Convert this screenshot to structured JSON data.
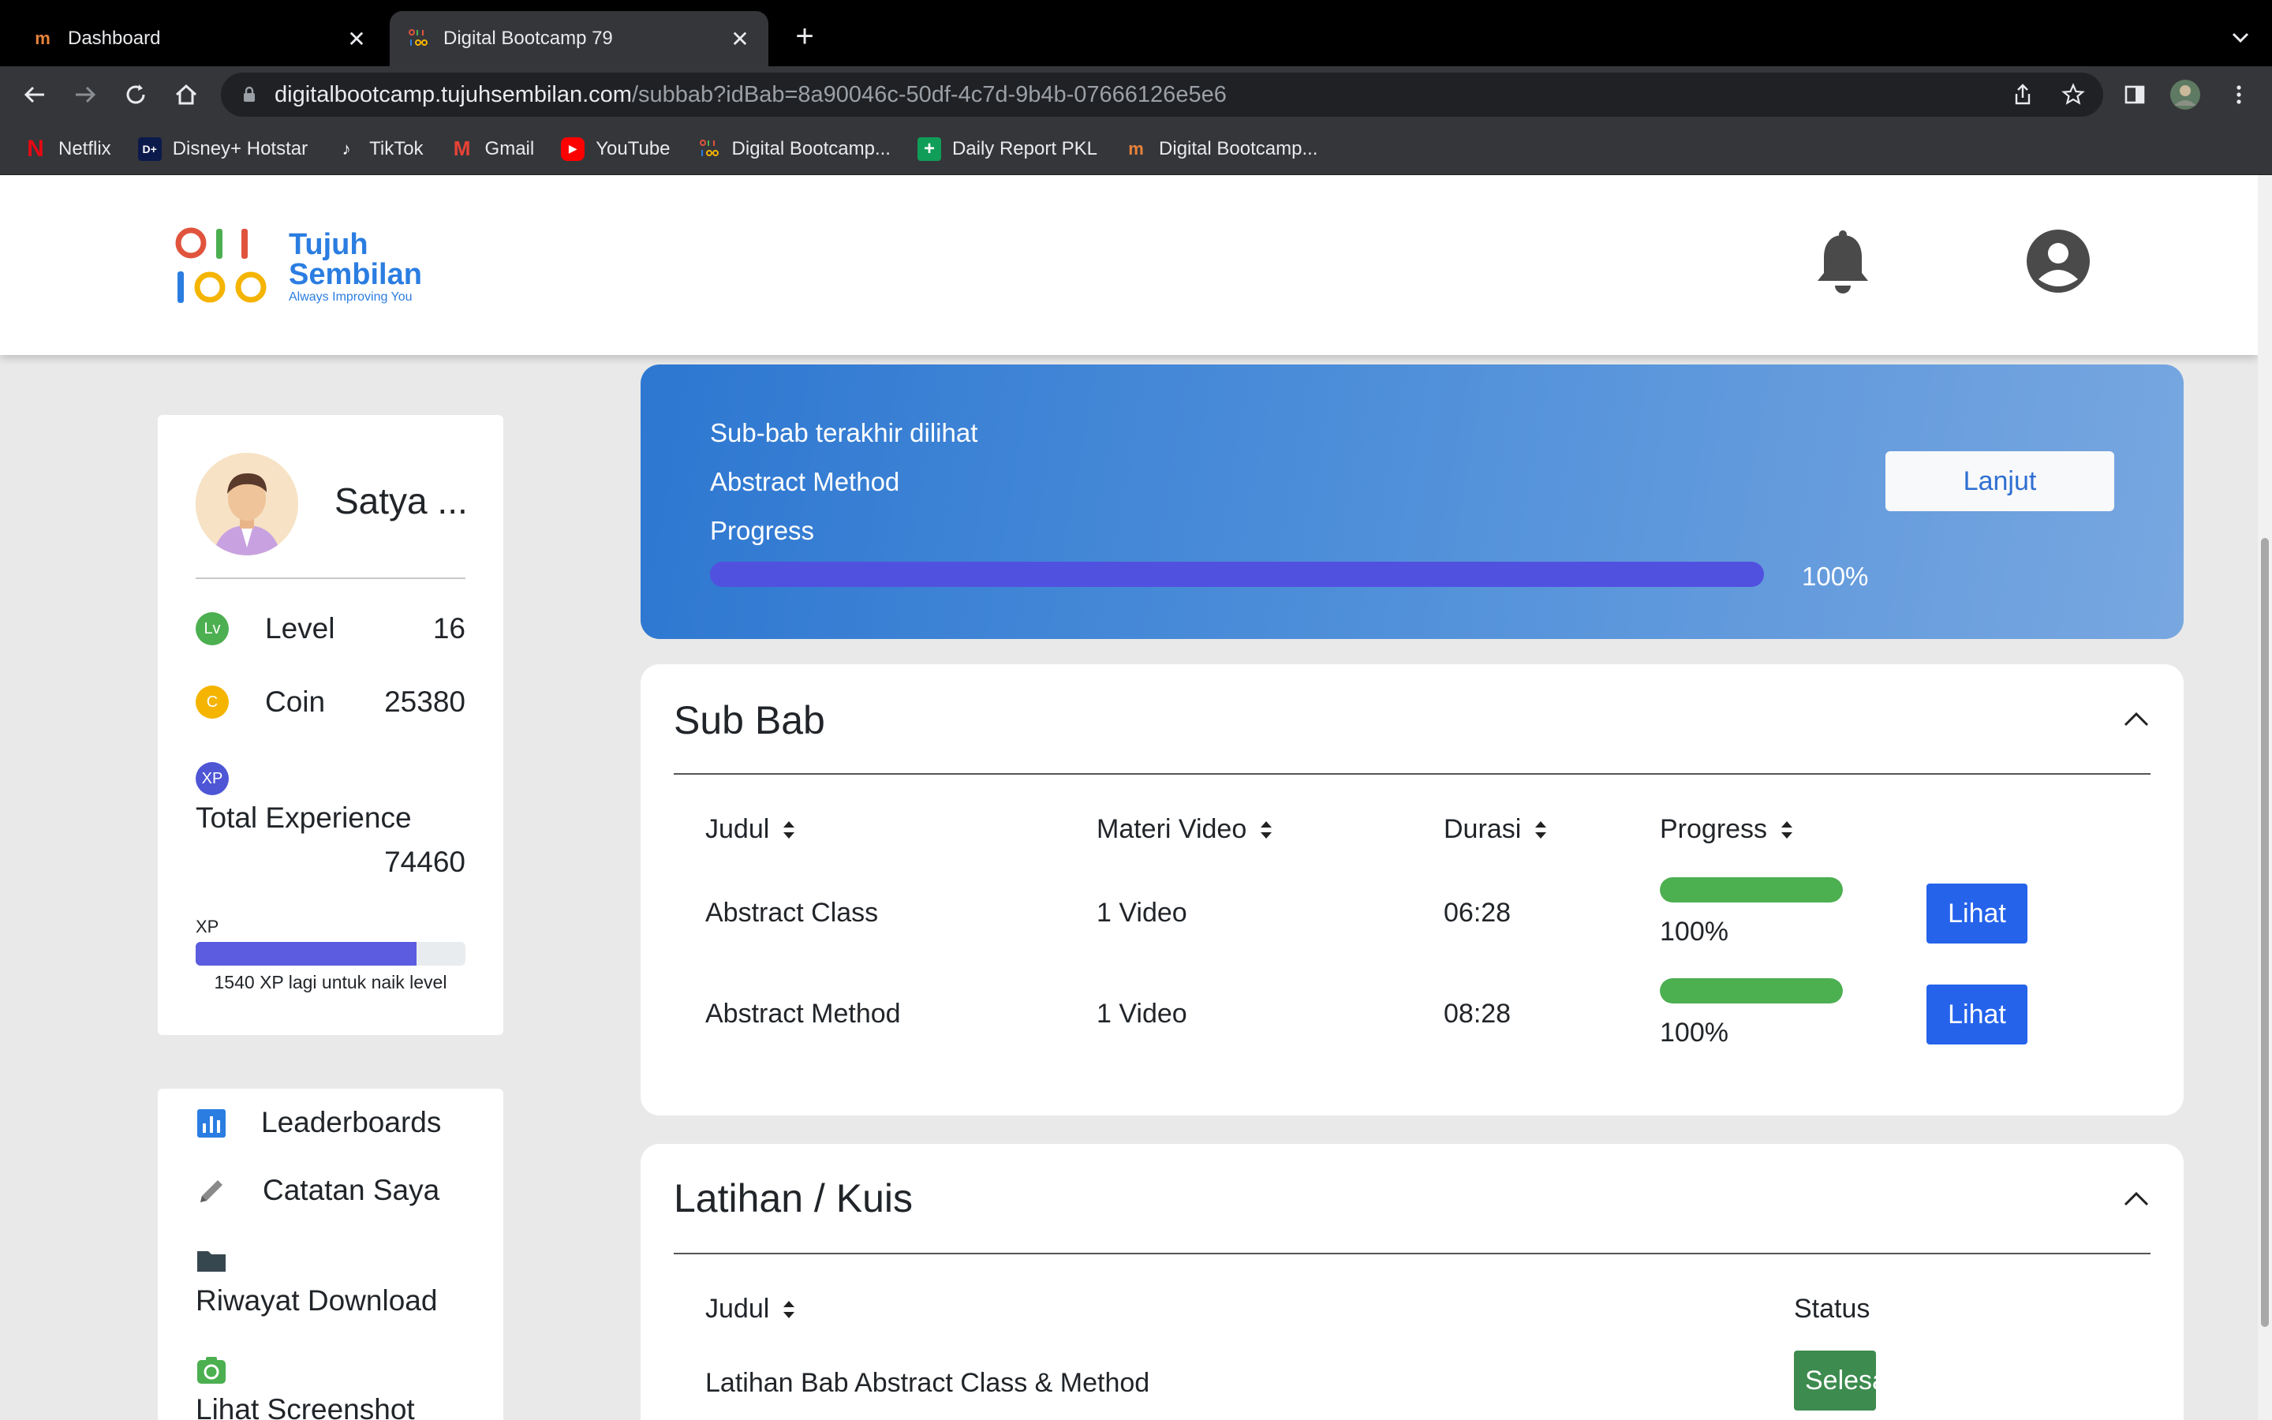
{
  "browser": {
    "tabs": [
      {
        "title": "Dashboard",
        "active": false,
        "favicon": "tujuhsembilan-icon"
      },
      {
        "title": "Digital Bootcamp 79",
        "active": true,
        "favicon": "digitalbootcamp-icon"
      }
    ],
    "url_host": "digitalbootcamp.tujuhsembilan.com",
    "url_path": "/subbab?idBab=8a90046c-50df-4c7d-9b4b-07666126e5e6",
    "bookmarks": [
      {
        "label": "Netflix",
        "icon": "netflix-icon"
      },
      {
        "label": "Disney+ Hotstar",
        "icon": "hotstar-icon"
      },
      {
        "label": "TikTok",
        "icon": "tiktok-icon"
      },
      {
        "label": "Gmail",
        "icon": "gmail-icon"
      },
      {
        "label": "YouTube",
        "icon": "youtube-icon"
      },
      {
        "label": "Digital Bootcamp...",
        "icon": "digitalbootcamp-icon"
      },
      {
        "label": "Daily Report PKL",
        "icon": "sheets-icon"
      },
      {
        "label": "Digital Bootcamp...",
        "icon": "tujuhsembilan-icon"
      }
    ]
  },
  "header": {
    "logo_line1": "Tujuh",
    "logo_line2": "Sembilan",
    "logo_tagline": "Always Improving You"
  },
  "profile": {
    "name": "Satya ...",
    "level_label": "Level",
    "level_value": "16",
    "level_badge": "Lv",
    "coin_label": "Coin",
    "coin_value": "25380",
    "coin_badge": "C",
    "xp_badge": "XP",
    "total_exp_label": "Total Experience",
    "total_exp_value": "74460",
    "xp_label": "XP",
    "xp_progress": 0.82,
    "xp_hint": "1540 XP lagi untuk naik level"
  },
  "menu": [
    {
      "label": "Leaderboards",
      "icon": "bar-chart-icon"
    },
    {
      "label": "Catatan Saya",
      "icon": "pencil-icon"
    },
    {
      "label": "Riwayat Download",
      "icon": "folder-icon"
    },
    {
      "label": "Lihat Screenshot",
      "icon": "screenshot-icon"
    }
  ],
  "hero": {
    "title": "Sub-bab terakhir dilihat",
    "subbab": "Abstract Method",
    "progress_label": "Progress",
    "progress_pct": "100%",
    "progress_value": 1.0,
    "button": "Lanjut"
  },
  "subbab": {
    "title": "Sub Bab",
    "columns": [
      "Judul",
      "Materi Video",
      "Durasi",
      "Progress"
    ],
    "rows": [
      {
        "judul": "Abstract Class",
        "materi": "1 Video",
        "durasi": "06:28",
        "progress": "100%",
        "progress_value": 1.0,
        "action": "Lihat"
      },
      {
        "judul": "Abstract Method",
        "materi": "1 Video",
        "durasi": "08:28",
        "progress": "100%",
        "progress_value": 1.0,
        "action": "Lihat"
      }
    ]
  },
  "latihan": {
    "title": "Latihan / Kuis",
    "columns": [
      "Judul",
      "Status"
    ],
    "rows": [
      {
        "judul": "Latihan Bab Abstract Class & Method",
        "status": "Selesai"
      }
    ]
  },
  "colors": {
    "accent_blue": "#2563eb",
    "success_green": "#4caf50",
    "xp_purple": "#5c5ce0",
    "level_green": "#4caf50",
    "coin_yellow": "#f4b400"
  }
}
